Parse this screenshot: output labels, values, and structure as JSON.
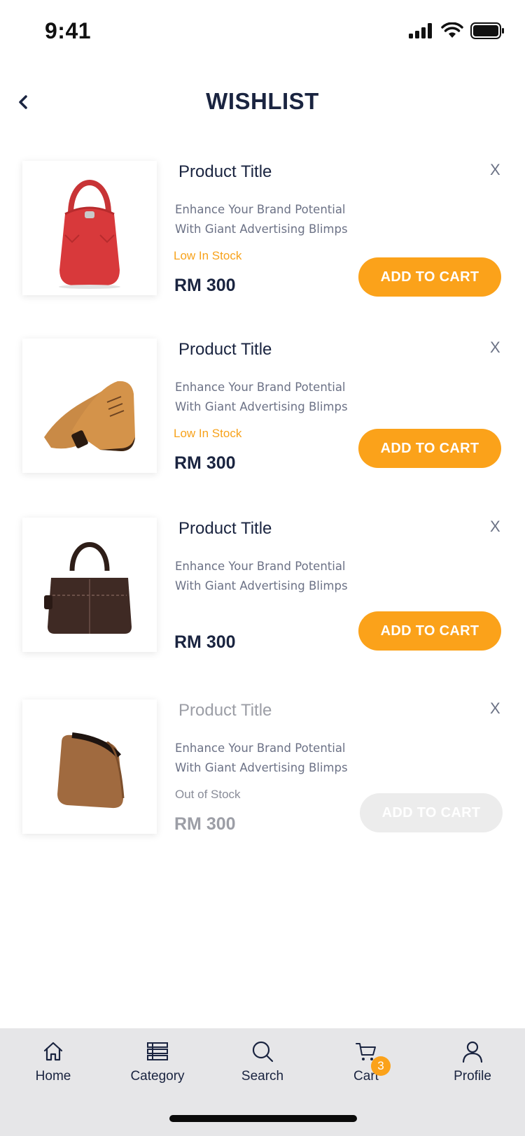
{
  "status_bar": {
    "time": "9:41"
  },
  "header": {
    "title": "WISHLIST"
  },
  "items": [
    {
      "title": "Product Title",
      "desc_line1": "Enhance Your Brand Potential",
      "desc_line2": "With Giant Advertising Blimps",
      "stock": "Low In Stock",
      "price": "RM 300",
      "button": "ADD TO CART",
      "remove": "X",
      "image": "red-handbag"
    },
    {
      "title": "Product Title",
      "desc_line1": "Enhance Your Brand Potential",
      "desc_line2": "With Giant Advertising Blimps",
      "stock": "Low In Stock",
      "price": "RM 300",
      "button": "ADD TO CART",
      "remove": "X",
      "image": "brown-oxford-shoes"
    },
    {
      "title": "Product Title",
      "desc_line1": "Enhance Your Brand Potential",
      "desc_line2": "With Giant Advertising Blimps",
      "stock": "",
      "price": "RM 300",
      "button": "ADD TO CART",
      "remove": "X",
      "image": "dark-brown-duffel-bag"
    },
    {
      "title": "Product Title",
      "desc_line1": "Enhance Your Brand Potential",
      "desc_line2": "With Giant Advertising Blimps",
      "stock": "Out of Stock",
      "price": "RM 300",
      "button": "ADD TO CART",
      "remove": "X",
      "image": "tan-toiletry-pouch"
    }
  ],
  "nav": {
    "home": "Home",
    "category": "Category",
    "search": "Search",
    "cart": "Cart",
    "cart_count": "3",
    "profile": "Profile"
  },
  "colors": {
    "accent": "#fba21a",
    "navy": "#1a2440",
    "disabled": "#ececec"
  }
}
